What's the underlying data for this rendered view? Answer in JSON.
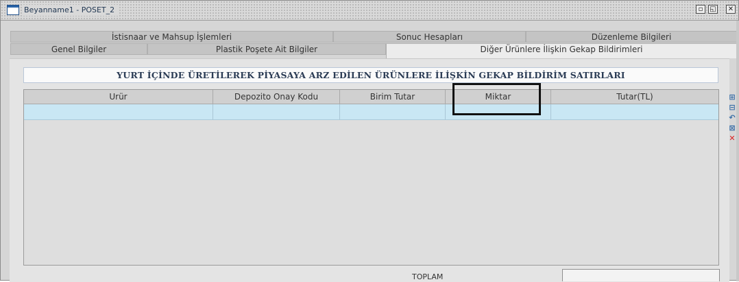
{
  "window": {
    "title": "Beyanname1 - POSET_2",
    "controls": [
      "minimize-icon",
      "maximize-icon",
      "close-icon"
    ],
    "control_glyphs": {
      "minimize": "▫",
      "maximize": "◱",
      "close": "✕"
    }
  },
  "tabs": {
    "row1": [
      {
        "label": "İstisnaar ve Mahsup İşlemleri"
      },
      {
        "label": "Sonuc Hesapları"
      },
      {
        "label": "Düzenleme Bilgileri"
      }
    ],
    "row2": [
      {
        "label": "Genel Bilgiler"
      },
      {
        "label": "Plastik Poşete Ait Bilgiler"
      },
      {
        "label": "Diğer Ürünlere İlişkin Gekap Bildirimleri",
        "active": true
      }
    ]
  },
  "section": {
    "title": "YURT İÇİNDE ÜRETİLEREK PİYASAYA ARZ EDİLEN ÜRÜNLERE İLİŞKİN GEKAP BİLDİRİM SATIRLARI"
  },
  "grid": {
    "columns": [
      "Urür",
      "Depozito Onay Kodu",
      "Birim Tutar",
      "Miktar",
      "Tutar(TL)"
    ],
    "rows": [
      [
        "",
        "",
        "",
        "",
        ""
      ]
    ]
  },
  "side_tools": [
    {
      "name": "add-row-icon",
      "glyph": "⊞"
    },
    {
      "name": "remove-row-icon",
      "glyph": "⊟"
    },
    {
      "name": "undo-row-icon",
      "glyph": "↶"
    },
    {
      "name": "clear-row-icon",
      "glyph": "⊠"
    },
    {
      "name": "delete-row-icon",
      "glyph": "✕"
    }
  ],
  "footer": {
    "total_label": "TOPLAM",
    "total_value": ""
  },
  "colors": {
    "selected_row": "#c9e7f4",
    "title_text": "#2b3c55",
    "delete": "#dd2222"
  }
}
